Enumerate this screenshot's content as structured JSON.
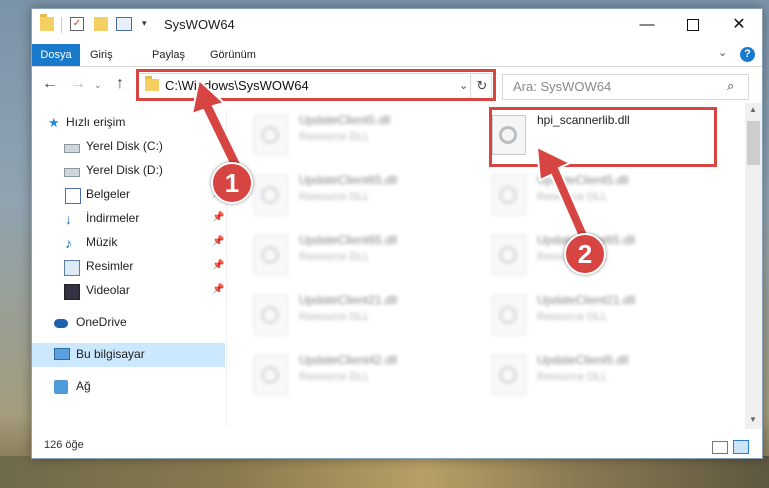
{
  "window": {
    "title": "SysWOW64",
    "controls": {
      "minimize": "—",
      "maximize": "",
      "close": "✕"
    }
  },
  "ribbon": {
    "tabs": [
      {
        "label": "Dosya",
        "active": true
      },
      {
        "label": "Giriş"
      },
      {
        "label": "Paylaş"
      },
      {
        "label": "Görünüm"
      }
    ],
    "help": "?"
  },
  "nav": {
    "address": "C:\\Windows\\SysWOW64",
    "search_placeholder": "Ara: SysWOW64"
  },
  "sidebar": {
    "items": [
      {
        "label": "Hızlı erişim",
        "icon": "star-icon"
      },
      {
        "label": "Yerel Disk (C:)",
        "icon": "drive-icon",
        "pinned": true
      },
      {
        "label": "Yerel Disk (D:)",
        "icon": "drive-icon",
        "pinned": true
      },
      {
        "label": "Belgeler",
        "icon": "documents-icon",
        "pinned": true
      },
      {
        "label": "İndirmeler",
        "icon": "downloads-icon",
        "pinned": true
      },
      {
        "label": "Müzik",
        "icon": "music-icon",
        "pinned": true
      },
      {
        "label": "Resimler",
        "icon": "pictures-icon",
        "pinned": true
      },
      {
        "label": "Videolar",
        "icon": "videos-icon",
        "pinned": true
      },
      {
        "label": "OneDrive",
        "icon": "onedrive-icon"
      },
      {
        "label": "Bu bilgisayar",
        "icon": "this-pc-icon",
        "selected": true
      },
      {
        "label": "Ağ",
        "icon": "network-icon"
      }
    ]
  },
  "files": [
    {
      "name": "UpdateClient5.dll",
      "type": "Resource DLL",
      "blurred": true
    },
    {
      "name": "hpi_scannerlib.dll",
      "type": "",
      "blurred": false,
      "highlighted": true
    },
    {
      "name": "UpdateClient65.dll",
      "type": "Resource DLL",
      "blurred": true
    },
    {
      "name": "UpdateClient5.dll",
      "type": "Resource DLL",
      "blurred": true
    },
    {
      "name": "UpdateClient65.dll",
      "type": "Resource DLL",
      "blurred": true
    },
    {
      "name": "UpdateClient65.dll",
      "type": "Resource DLL",
      "blurred": true
    },
    {
      "name": "UpdateClient21.dll",
      "type": "Resource DLL",
      "blurred": true
    },
    {
      "name": "UpdateClient21.dll",
      "type": "Resource DLL",
      "blurred": true
    },
    {
      "name": "UpdateClient42.dll",
      "type": "Resource DLL",
      "blurred": true
    },
    {
      "name": "UpdateClient5.dll",
      "type": "Resource DLL",
      "blurred": true
    }
  ],
  "status": {
    "item_count": "126 öğe"
  },
  "callouts": [
    {
      "label": "1"
    },
    {
      "label": "2"
    }
  ],
  "colors": {
    "accent": "#1979ca",
    "callout": "#d64541",
    "selection": "#cce8ff"
  }
}
